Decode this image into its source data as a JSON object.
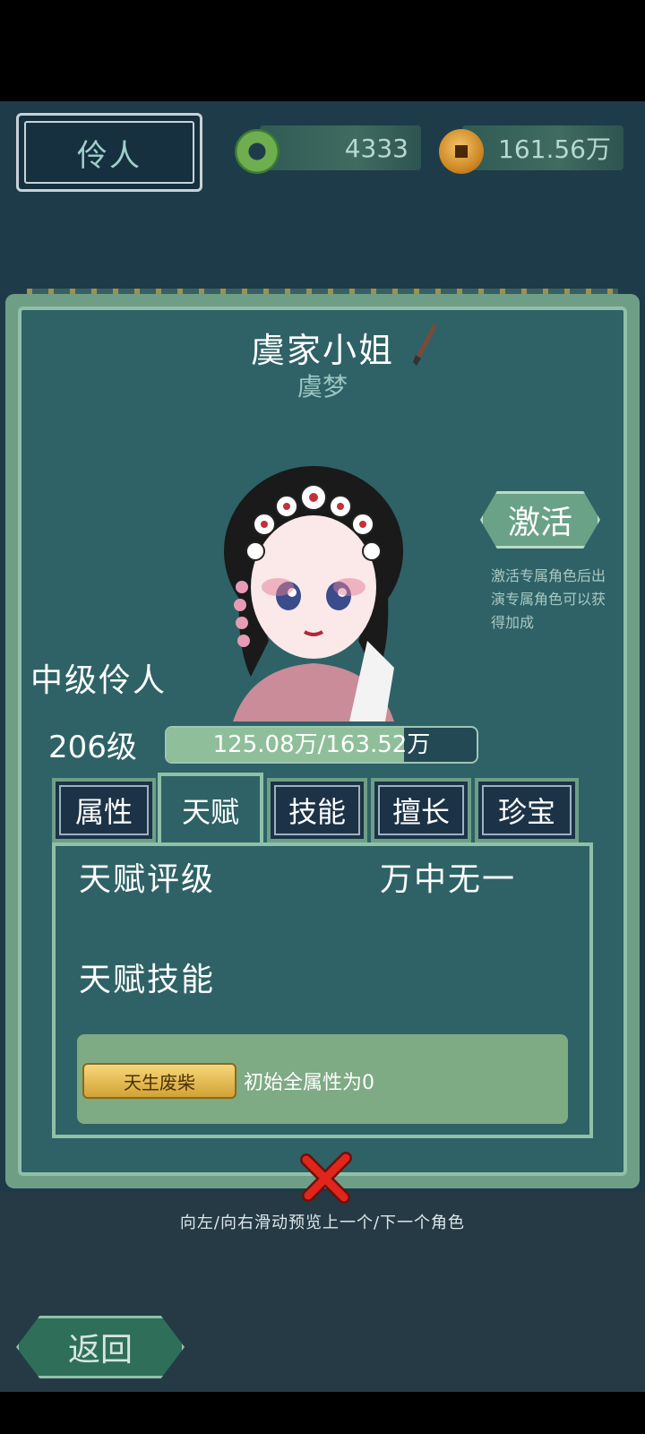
{
  "header": {
    "title": "伶人",
    "jade_amount": "4333",
    "coin_amount": "161.56万"
  },
  "character": {
    "name": "虞家小姐",
    "subname": "虞梦",
    "rank": "中级伶人",
    "level": "206级",
    "exp_text": "125.08万/163.52万",
    "exp_progress": 0.765
  },
  "activate": {
    "label": "激活",
    "description": "激活专属角色后出演专属角色可以获得加成"
  },
  "tabs": [
    {
      "label": "属性"
    },
    {
      "label": "天赋"
    },
    {
      "label": "技能"
    },
    {
      "label": "擅长"
    },
    {
      "label": "珍宝"
    }
  ],
  "talent": {
    "rating_label": "天赋评级",
    "rating_value": "万中无一",
    "skill_label": "天赋技能",
    "skill_badge": "天生废柴",
    "skill_desc": "初始全属性为0"
  },
  "footer": {
    "swipe_hint": "向左/向右滑动预览上一个/下一个角色",
    "back_label": "返回"
  },
  "colors": {
    "panel": "#2e6266",
    "accent": "#8fc1a8",
    "close": "#e0261b"
  }
}
